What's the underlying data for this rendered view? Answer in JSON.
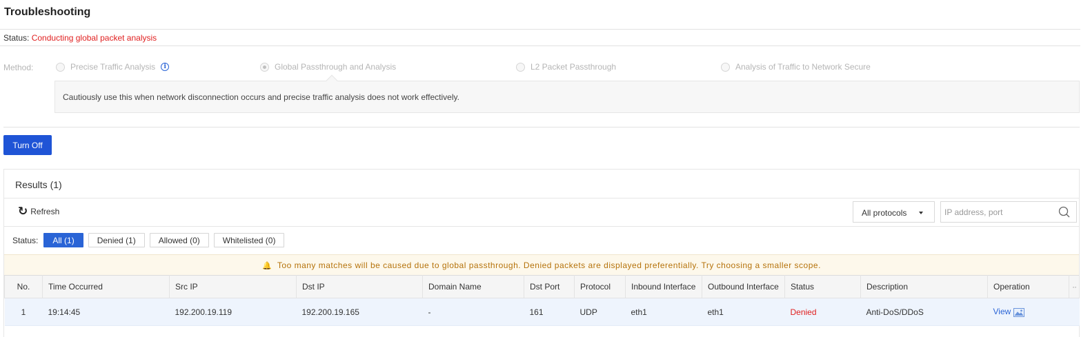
{
  "page": {
    "title": "Troubleshooting"
  },
  "status": {
    "label": "Status:",
    "value": "Conducting global packet analysis"
  },
  "method": {
    "label": "Method:",
    "options": [
      {
        "label": "Precise Traffic Analysis",
        "checked": false
      },
      {
        "label": "Global Passthrough and Analysis",
        "checked": true
      },
      {
        "label": "L2 Packet Passthrough",
        "checked": false
      },
      {
        "label": "Analysis of Traffic to Network Secure",
        "checked": false
      }
    ],
    "hint": "Cautiously use this when network disconnection occurs and precise traffic analysis does not work effectively."
  },
  "actions": {
    "turn_off": "Turn Off"
  },
  "results": {
    "title": "Results (1)",
    "refresh": "Refresh",
    "protocol_select": "All protocols",
    "search_placeholder": "IP address, port",
    "filter_label": "Status:",
    "filters": [
      "All (1)",
      "Denied (1)",
      "Allowed (0)",
      "Whitelisted (0)"
    ],
    "warning": "Too many matches will be caused due to global passthrough. Denied packets are displayed preferentially. Try choosing a smaller scope.",
    "columns": [
      "No.",
      "Time Occurred",
      "Src IP",
      "Dst IP",
      "Domain Name",
      "Dst Port",
      "Protocol",
      "Inbound Interface",
      "Outbound Interface",
      "Status",
      "Description",
      "Operation"
    ],
    "rows": [
      {
        "no": "1",
        "time": "19:14:45",
        "src_ip": "192.200.19.119",
        "dst_ip": "192.200.19.165",
        "domain": "-",
        "dst_port": "161",
        "protocol": "UDP",
        "inbound": "eth1",
        "outbound": "eth1",
        "status": "Denied",
        "description": "Anti-DoS/DDoS",
        "operation": "View"
      }
    ]
  },
  "colors": {
    "primary": "#1f54d6",
    "link": "#2a64d6",
    "danger": "#e02020",
    "warning_text": "#b5720a",
    "warning_bg": "#fdf8eb"
  },
  "icons": [
    "info-icon",
    "refresh-icon",
    "chevron-down-icon",
    "search-icon",
    "bell-icon",
    "image-icon",
    "more-icon"
  ]
}
